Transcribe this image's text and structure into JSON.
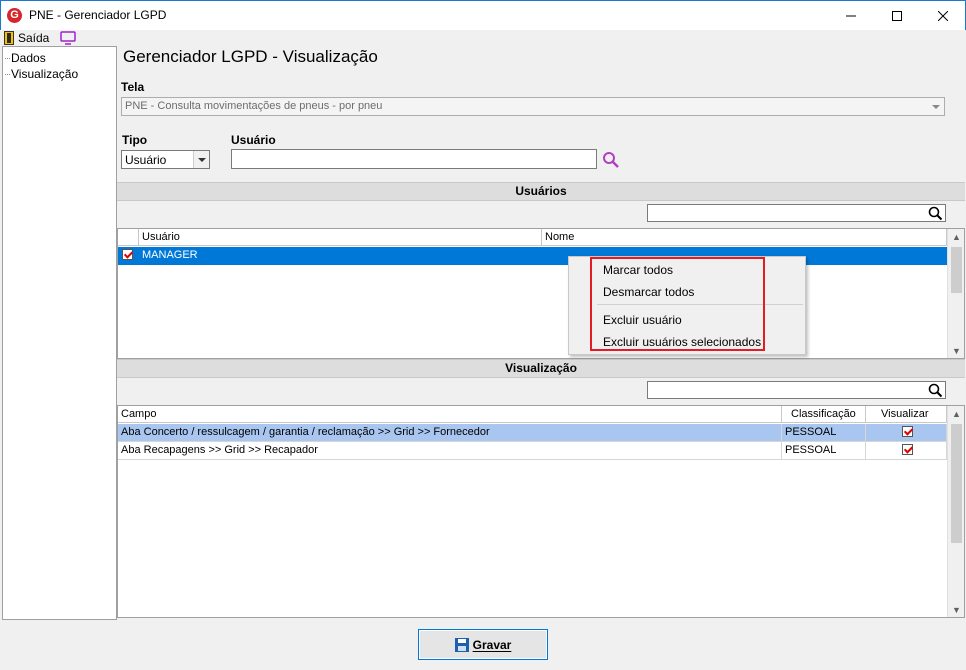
{
  "window": {
    "title": "PNE - Gerenciador LGPD",
    "app_icon_letter": "G"
  },
  "toolbar": {
    "exit_label": "Saída",
    "monitor_icon": "monitor-icon"
  },
  "tree": {
    "items": [
      {
        "label": "Dados"
      },
      {
        "label": "Visualização"
      }
    ]
  },
  "main": {
    "title": "Gerenciador LGPD - Visualização",
    "tela_label": "Tela",
    "tela_value": "PNE - Consulta movimentações de pneus - por pneu",
    "tipo_label": "Tipo",
    "tipo_value": "Usuário",
    "usuario_label": "Usuário",
    "usuario_value": ""
  },
  "users_section": {
    "title": "Usuários",
    "filter_value": "",
    "columns": [
      "Usuário",
      "Nome"
    ],
    "rows": [
      {
        "checked": true,
        "usuario": "MANAGER",
        "nome": ""
      }
    ]
  },
  "context_menu": {
    "items": [
      "Marcar todos",
      "Desmarcar todos",
      "Excluir usuário",
      "Excluir usuários selecionados"
    ]
  },
  "view_section": {
    "title": "Visualização",
    "filter_value": "",
    "columns": [
      "Campo",
      "Classificação",
      "Visualizar"
    ],
    "rows": [
      {
        "campo": "Aba Concerto / ressulcagem / garantia / reclamação >> Grid >> Fornecedor",
        "classificacao": "PESSOAL",
        "visualizar": true
      },
      {
        "campo": "Aba Recapagens >> Grid >> Recapador",
        "classificacao": "PESSOAL",
        "visualizar": true
      }
    ]
  },
  "footer": {
    "save_label": "Gravar"
  },
  "colors": {
    "selection": "#0078d7",
    "selection_light": "#a9c6f0",
    "highlight_box": "#e41b23",
    "window_border": "#1979ca"
  }
}
